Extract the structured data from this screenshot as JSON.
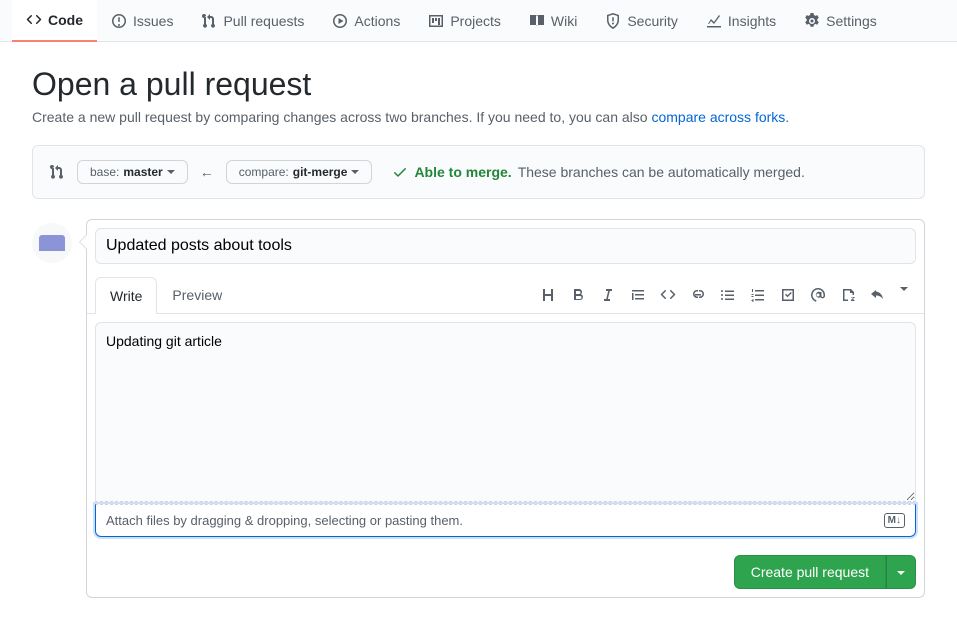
{
  "nav": {
    "code": "Code",
    "issues": "Issues",
    "pulls": "Pull requests",
    "actions": "Actions",
    "projects": "Projects",
    "wiki": "Wiki",
    "security": "Security",
    "insights": "Insights",
    "settings": "Settings"
  },
  "header": {
    "title": "Open a pull request",
    "subtitle_pre": "Create a new pull request by comparing changes across two branches. If you need to, you can also ",
    "subtitle_link": "compare across forks",
    "subtitle_post": "."
  },
  "range": {
    "base_label": "base: ",
    "base_value": "master",
    "compare_label": "compare: ",
    "compare_value": "git-merge",
    "merge_ok": "Able to merge.",
    "merge_desc": "These branches can be automatically merged."
  },
  "compose": {
    "title_value": "Updated posts about tools",
    "tab_write": "Write",
    "tab_preview": "Preview",
    "body_value": "Updating git article",
    "attach_hint": "Attach files by dragging & dropping, selecting or pasting them.",
    "md_badge": "M↓"
  },
  "actions": {
    "create": "Create pull request"
  }
}
